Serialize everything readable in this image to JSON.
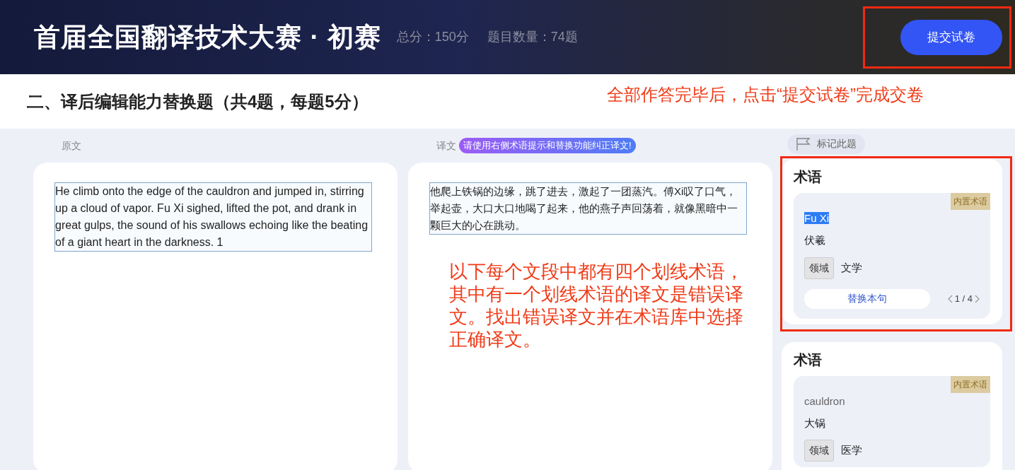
{
  "header": {
    "title": "首届全国翻译技术大赛 · 初赛",
    "total_score": "总分：150分",
    "question_count": "题目数量：74题",
    "submit_button": "提交试卷"
  },
  "section_title": "二、译后编辑能力替换题（共4题，每题5分）",
  "source": {
    "label": "原文",
    "text": "He climb onto the edge of the cauldron and jumped in, stirring up a cloud of vapor. Fu Xi sighed, lifted the pot, and drank in great gulps, the sound of his swallows echoing like the beating of a giant heart in the darkness. 1"
  },
  "target": {
    "label": "译文",
    "hint": "请使用右侧术语提示和替换功能纠正译文!",
    "text": "他爬上铁锅的边缘，跳了进去，激起了一团蒸汽。傅Xi叹了口气，举起壶，大口大口地喝了起来，他的燕子声回荡着，就像黑暗中一颗巨大的心在跳动。"
  },
  "mark_button": "标记此题",
  "term_cards": [
    {
      "title": "术语",
      "badge": "内置术语",
      "term": "Fu Xi",
      "highlighted": true,
      "translation": "伏羲",
      "domain_label": "领域",
      "domain": "文学",
      "replace_button": "替换本句",
      "pager": "1 / 4"
    },
    {
      "title": "术语",
      "badge": "内置术语",
      "term": "cauldron",
      "highlighted": false,
      "translation": "大锅",
      "domain_label": "领域",
      "domain": "医学"
    }
  ],
  "annotations": [
    {
      "kind": "note",
      "text": "全部作答完毕后，点击“提交试卷”完成交卷"
    },
    {
      "kind": "note",
      "text": "以下每个文段中都有四个划线术语，其中有一个划线术语的译文是错误译文。找出错误译文并在术语库中选择正确译文。"
    }
  ]
}
